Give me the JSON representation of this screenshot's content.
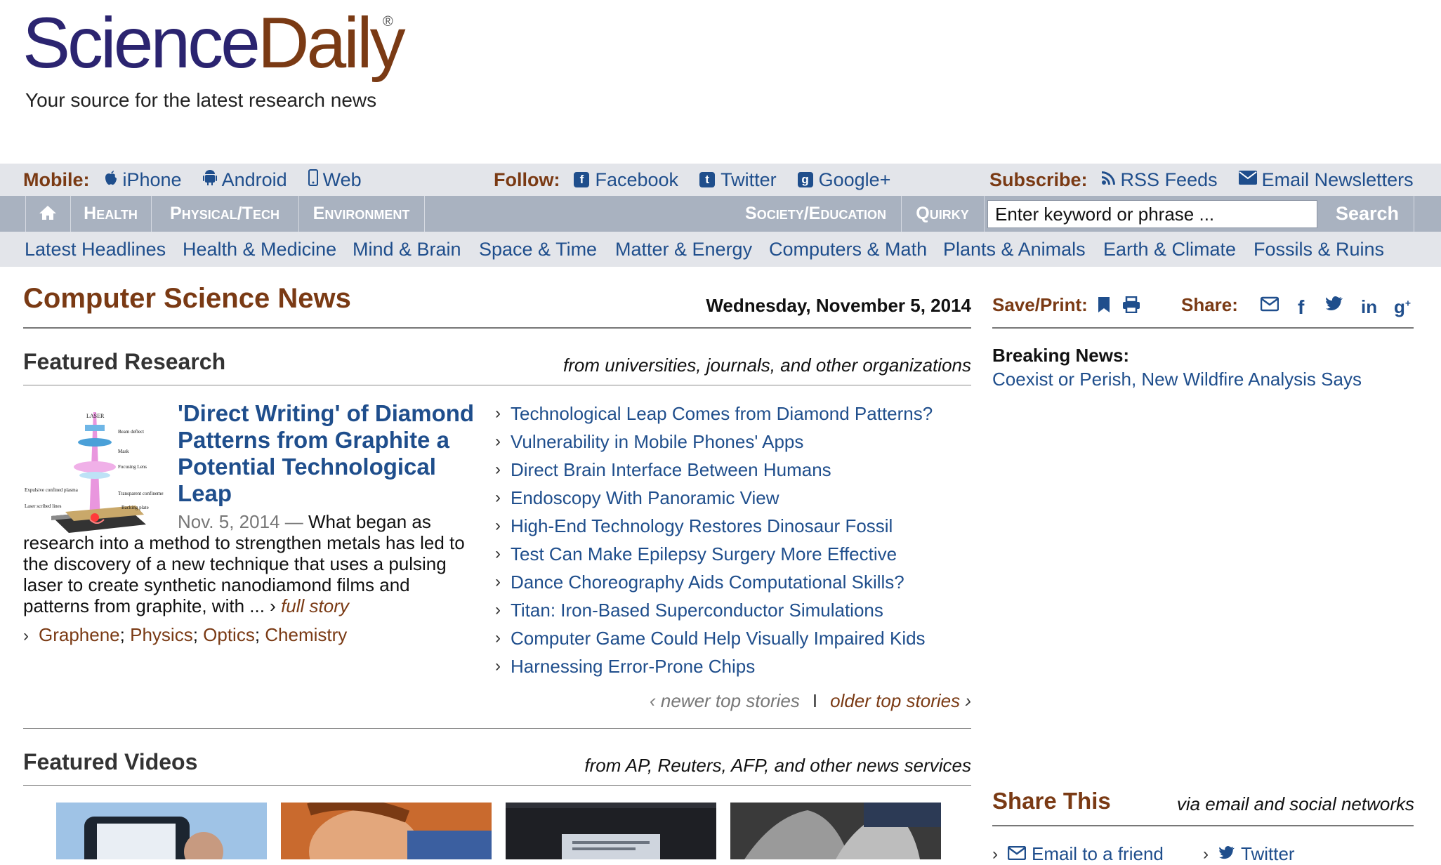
{
  "brand": {
    "logo_science": "Science",
    "logo_daily": "Daily",
    "registered": "®",
    "tagline": "Your source for the latest research news"
  },
  "topbar": {
    "mobile_label": "Mobile",
    "mobile_links": [
      "iPhone",
      "Android",
      "Web"
    ],
    "follow_label": "Follow",
    "follow_links": [
      "Facebook",
      "Twitter",
      "Google+"
    ],
    "subscribe_label": "Subscribe",
    "subscribe_links": [
      "RSS Feeds",
      "Email Newsletters"
    ]
  },
  "sections": {
    "left": [
      "Health",
      "Physical/Tech",
      "Environment"
    ],
    "right": [
      "Society/Education",
      "Quirky"
    ]
  },
  "search": {
    "value": "Enter keyword or phrase ...",
    "button": "Search"
  },
  "topics": [
    "Latest Headlines",
    "Health & Medicine",
    "Mind & Brain",
    "Space & Time",
    "Matter & Energy",
    "Computers & Math",
    "Plants & Animals",
    "Earth & Climate",
    "Fossils & Ruins"
  ],
  "page": {
    "title": "Computer Science News",
    "date": "Wednesday, November 5, 2014"
  },
  "featured_research": {
    "heading": "Featured Research",
    "subheading": "from universities, journals, and other organizations",
    "lead": {
      "title": "'Direct Writing' of Diamond Patterns from Graphite a Potential Technological Leap",
      "date": "Nov. 5, 2014",
      "dash": " — ",
      "summary": "What began as research into a method to strengthen metals has led to the discovery of a new technique that uses a pulsing laser to create synthetic nanodiamond films and patterns from graphite, with ... ",
      "more": "full story",
      "tags": [
        "Graphene",
        "Physics",
        "Optics",
        "Chemistry"
      ],
      "image_labels": [
        "LASER",
        "Beam deflect",
        "Mask",
        "Focusing Lens",
        "Expulsive confined plasma",
        "Transparent confinement",
        "Laser scribed lines",
        "Backing plate"
      ]
    },
    "stories": [
      "Technological Leap Comes from Diamond Patterns?",
      "Vulnerability in Mobile Phones' Apps",
      "Direct Brain Interface Between Humans",
      "Endoscopy With Panoramic View",
      "High-End Technology Restores Dinosaur Fossil",
      "Test Can Make Epilepsy Surgery More Effective",
      "Dance Choreography Aids Computational Skills?",
      "Titan: Iron-Based Superconductor Simulations",
      "Computer Game Could Help Visually Impaired Kids",
      "Harnessing Error-Prone Chips"
    ],
    "newer": "newer top stories",
    "older": "older top stories"
  },
  "featured_videos": {
    "heading": "Featured Videos",
    "subheading": "from AP, Reuters, AFP, and other news services"
  },
  "sidebar": {
    "save_label": "Save/Print:",
    "share_label": "Share:",
    "breaking_heading": "Breaking News:",
    "breaking_link": "Coexist or Perish, New Wildfire Analysis Says",
    "share_this": "Share This",
    "share_this_sub": "via email and social networks",
    "share_links": [
      "Email to a friend",
      "Twitter"
    ]
  },
  "colors": {
    "brand_navy": "#2b2470",
    "brand_brown": "#7a3a14",
    "link_blue": "#1f4e8c",
    "nav_gray": "#a9b2c0",
    "bar_light": "#e3e5ea"
  }
}
